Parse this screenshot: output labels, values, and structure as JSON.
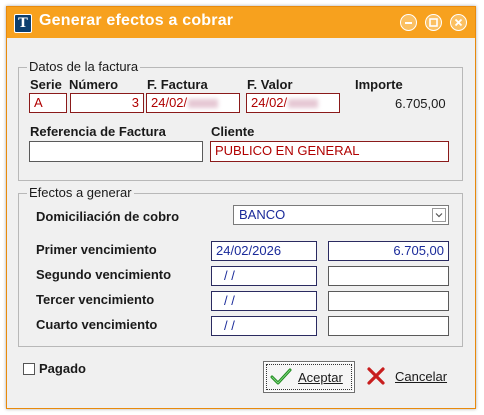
{
  "window": {
    "title": "Generar efectos a cobrar",
    "accent": "#f7a11e"
  },
  "factura": {
    "legend": "Datos de la factura",
    "labels": {
      "serie": "Serie",
      "numero": "Número",
      "fecha": "F. Factura",
      "valor": "F. Valor",
      "importe": "Importe",
      "referencia": "Referencia de Factura",
      "cliente": "Cliente"
    },
    "values": {
      "serie": "A",
      "numero": "3",
      "fecha": "24/02/",
      "valor": "24/02/",
      "importe": "6.705,00",
      "referencia": "",
      "cliente": "PUBLICO EN GENERAL"
    }
  },
  "efectos": {
    "legend": "Efectos a generar",
    "domiciliacion_label": "Domiciliación de cobro",
    "domiciliacion_value": "BANCO",
    "rows": [
      {
        "label": "Primer vencimiento",
        "date": "24/02/2026",
        "amount": "6.705,00"
      },
      {
        "label": "Segundo vencimiento",
        "date": "/ /",
        "amount": ""
      },
      {
        "label": "Tercer vencimiento",
        "date": "/ /",
        "amount": ""
      },
      {
        "label": "Cuarto vencimiento",
        "date": "/ /",
        "amount": ""
      }
    ]
  },
  "footer": {
    "pagado_label": "Pagado",
    "aceptar": "Aceptar",
    "cancelar": "Cancelar"
  },
  "icons": {
    "app": "document-icon",
    "ok": "check-icon",
    "cancel": "x-icon"
  }
}
